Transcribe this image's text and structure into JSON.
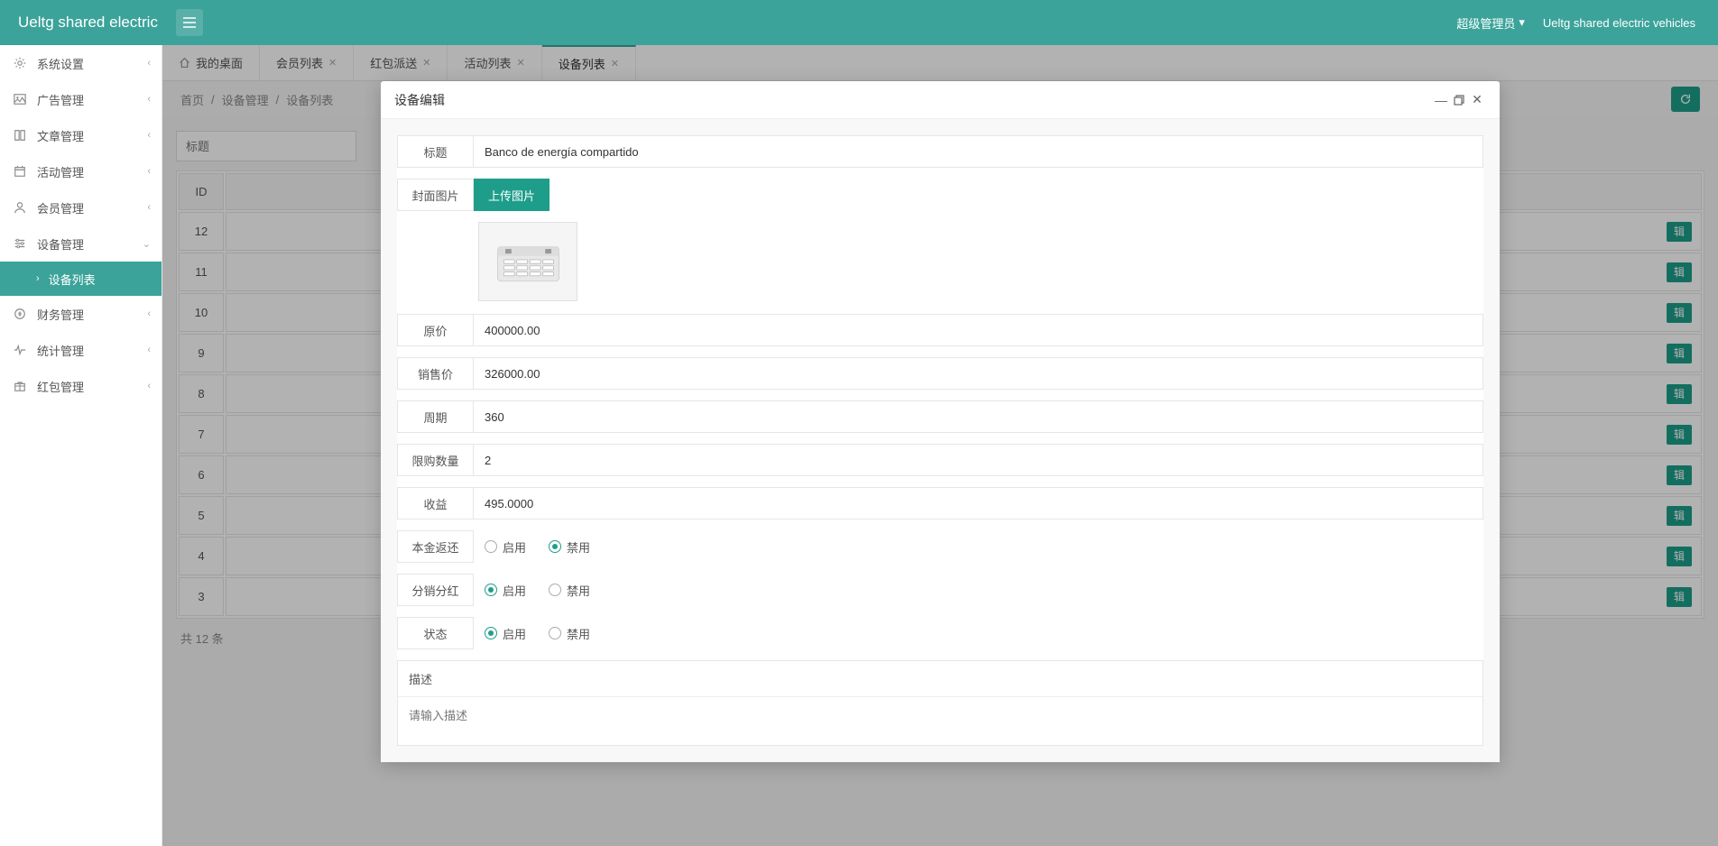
{
  "header": {
    "brand": "Ueltg shared electric",
    "user_label": "超级管理员",
    "app_name": "Ueltg shared electric vehicles"
  },
  "sidebar": {
    "items": [
      {
        "label": "系统设置",
        "icon": "gear"
      },
      {
        "label": "广告管理",
        "icon": "image"
      },
      {
        "label": "文章管理",
        "icon": "book"
      },
      {
        "label": "活动管理",
        "icon": "calendar"
      },
      {
        "label": "会员管理",
        "icon": "user"
      },
      {
        "label": "设备管理",
        "icon": "sliders",
        "expanded": true
      },
      {
        "label": "财务管理",
        "icon": "coin"
      },
      {
        "label": "统计管理",
        "icon": "pulse"
      },
      {
        "label": "红包管理",
        "icon": "gift"
      }
    ],
    "active_sub": "设备列表"
  },
  "tabs": [
    {
      "label": "我的桌面",
      "icon": "home",
      "closable": false
    },
    {
      "label": "会员列表",
      "closable": true
    },
    {
      "label": "红包派送",
      "closable": true
    },
    {
      "label": "活动列表",
      "closable": true
    },
    {
      "label": "设备列表",
      "closable": true,
      "active": true
    }
  ],
  "breadcrumb": [
    "首页",
    "设备管理",
    "设备列表"
  ],
  "search": {
    "placeholder": "标题"
  },
  "table": {
    "headers": [
      "ID"
    ],
    "rows": [
      12,
      11,
      10,
      9,
      8,
      7,
      6,
      5,
      4,
      3
    ],
    "op_label": "辑"
  },
  "footer": "共 12 条",
  "modal": {
    "title": "设备编辑",
    "fields": {
      "title_label": "标题",
      "title_value": "Banco de energía compartido",
      "cover_label": "封面图片",
      "upload_label": "上传图片",
      "original_price_label": "原价",
      "original_price_value": "400000.00",
      "sale_price_label": "销售价",
      "sale_price_value": "326000.00",
      "cycle_label": "周期",
      "cycle_value": "360",
      "limit_label": "限购数量",
      "limit_value": "2",
      "profit_label": "收益",
      "profit_value": "495.0000",
      "principal_return_label": "本金返还",
      "distribution_label": "分销分红",
      "status_label": "状态",
      "enable": "启用",
      "disable": "禁用",
      "desc_label": "描述",
      "desc_placeholder": "请输入描述"
    }
  }
}
